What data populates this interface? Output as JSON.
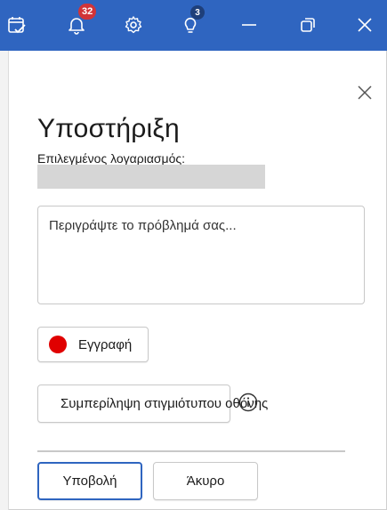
{
  "titlebar": {
    "accent": "#2f65c0",
    "icons": [
      {
        "name": "calendar-check-icon"
      },
      {
        "name": "bell-icon",
        "badge": "32"
      },
      {
        "name": "gear-icon"
      },
      {
        "name": "lightbulb-icon",
        "badge": "3"
      },
      {
        "name": "minimize-icon"
      },
      {
        "name": "restore-icon"
      },
      {
        "name": "close-icon"
      }
    ],
    "notifications_badge": "32",
    "tips_badge": "3"
  },
  "support": {
    "title": "Υποστήριξη",
    "account_label": "Επιλεγμένος λογαριασμός:",
    "description_placeholder": "Περιγράψτε το πρόβλημά σας...",
    "record_label": "Εγγραφή",
    "screenshot_label": "Συμπερίληψη στιγμιότυπου οθόνης",
    "submit_label": "Υποβολή",
    "cancel_label": "Άκυρο"
  }
}
